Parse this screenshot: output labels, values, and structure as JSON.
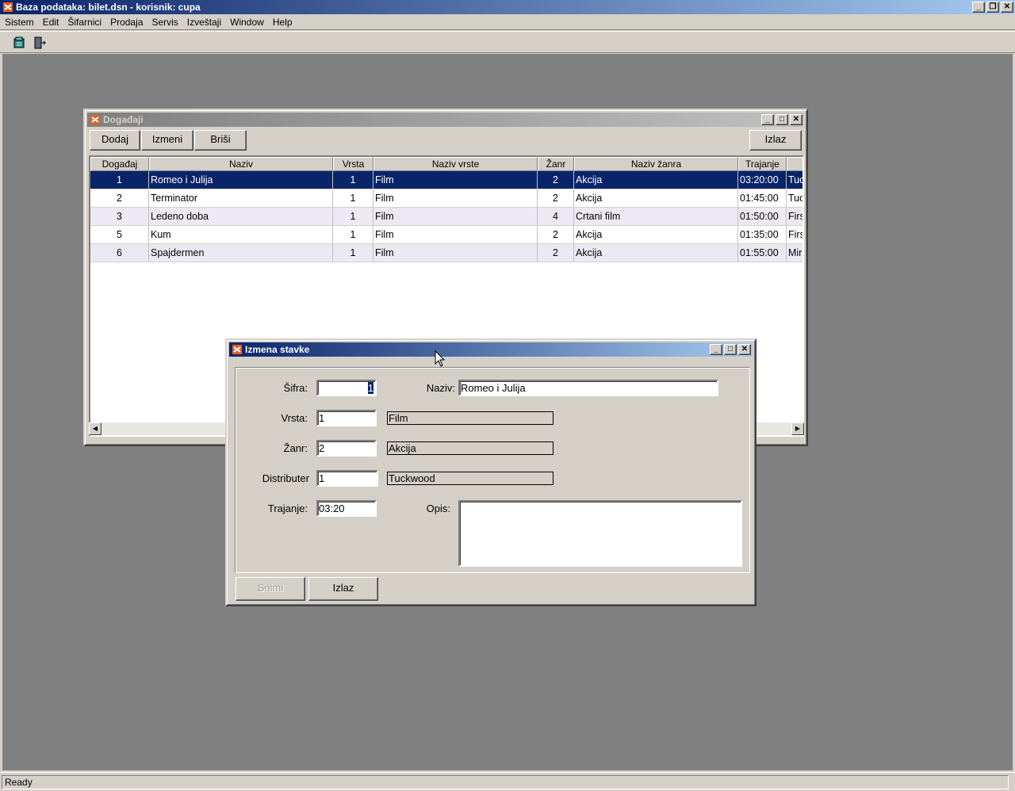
{
  "app": {
    "title": "Baza podataka: bilet.dsn  -  korisnik: cupa",
    "menu": [
      "Sistem",
      "Edit",
      "Šifarnici",
      "Prodaja",
      "Servis",
      "Izveštaji",
      "Window",
      "Help"
    ],
    "status": "Ready"
  },
  "events_window": {
    "title": "Događaji",
    "buttons": {
      "add": "Dodaj",
      "edit": "Izmeni",
      "delete": "Briši",
      "exit": "Izlaz"
    },
    "columns": [
      "Događaj",
      "Naziv",
      "Vrsta",
      "Naziv vrste",
      "Žanr",
      "Naziv žanra",
      "Trajanje",
      ""
    ],
    "rows": [
      [
        "1",
        "Romeo i Julija",
        "1",
        "Film",
        "2",
        "Akcija",
        "03:20:00",
        "Tuc"
      ],
      [
        "2",
        "Terminator",
        "1",
        "Film",
        "2",
        "Akcija",
        "01:45:00",
        "Tuc"
      ],
      [
        "3",
        "Ledeno doba",
        "1",
        "Film",
        "4",
        "Crtani film",
        "01:50:00",
        "Firs"
      ],
      [
        "5",
        "Kum",
        "1",
        "Film",
        "2",
        "Akcija",
        "01:35:00",
        "Firs"
      ],
      [
        "6",
        "Spajdermen",
        "1",
        "Film",
        "2",
        "Akcija",
        "01:55:00",
        "Mir"
      ]
    ]
  },
  "edit_dialog": {
    "title": "Izmena stavke",
    "labels": {
      "sifra": "Šifra:",
      "naziv": "Naziv:",
      "vrsta": "Vrsta:",
      "zanr": "Žanr:",
      "distributer": "Distributer",
      "trajanje": "Trajanje:",
      "opis": "Opis:"
    },
    "values": {
      "sifra": "1",
      "naziv": "Romeo i Julija",
      "vrsta": "1",
      "vrsta_naziv": "Film",
      "zanr": "2",
      "zanr_naziv": "Akcija",
      "distributer": "1",
      "distributer_naziv": "Tuckwood",
      "trajanje": "03:20",
      "opis": ""
    },
    "buttons": {
      "save": "Snimi",
      "exit": "Izlaz"
    }
  }
}
